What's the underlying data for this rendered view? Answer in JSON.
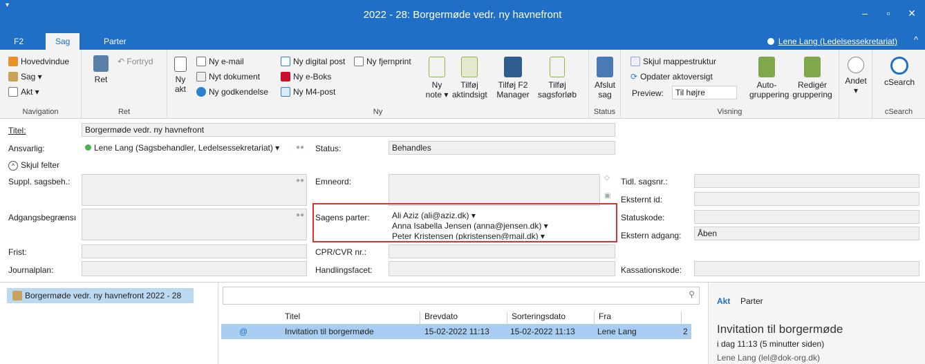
{
  "window": {
    "title": "2022 - 28: Borgermøde vedr. ny havnefront",
    "qa": "▾",
    "min": "‒",
    "max": "▫",
    "close": "✕"
  },
  "menu": {
    "tabs": [
      "F2",
      "Sag",
      "Parter"
    ],
    "user": "Lene Lang (Ledelsessekretariat)",
    "collapse": "^"
  },
  "ribbon": {
    "navigation": {
      "items": [
        "Hovedvindue",
        "Sag ▾",
        "Akt ▾"
      ],
      "label": "Navigation"
    },
    "ret": {
      "ret": "Ret",
      "fortryd": "Fortryd",
      "label": "Ret"
    },
    "ny": {
      "label": "Ny",
      "ny_akt": "Ny akt",
      "ny_email": "Ny e-mail",
      "nyt_dokument": "Nyt dokument",
      "ny_godkendelse": "Ny godkendelse",
      "ny_digital_post": "Ny digital post",
      "ny_eboks": "Ny e-Boks",
      "ny_m4": "Ny M4-post",
      "ny_fjernprint": "Ny fjernprint",
      "ny_note": "Ny note ▾",
      "tilfoj_aktindsigt": "Tilføj aktindsigt",
      "tilfoj_f2": "Tilføj F2 Manager",
      "tilfoj_sagsforlob": "Tilføj sagsforløb"
    },
    "status": {
      "label": "Status",
      "afslut": "Afslut sag"
    },
    "visning": {
      "label": "Visning",
      "skjul": "Skjul mappestruktur",
      "opdater": "Opdater aktoversigt",
      "preview_label": "Preview:",
      "preview_value": "Til højre",
      "auto": "Auto-gruppering",
      "rediger": "Redigér gruppering",
      "andet": "Andet ▾"
    },
    "csearch": {
      "label": "cSearch",
      "btn": "cSearch"
    }
  },
  "form": {
    "titel_label": "Titel:",
    "titel": "Borgermøde vedr. ny havnefront",
    "ansvarlig_label": "Ansvarlig:",
    "ansvarlig": "Lene Lang (Sagsbehandler, Ledelsessekretariat) ▾",
    "status_label": "Status:",
    "status": "Behandles",
    "skjul": "Skjul felter",
    "suppl_label": "Suppl. sagsbeh.:",
    "emneord_label": "Emneord:",
    "tidl_label": "Tidl. sagsnr.:",
    "ekstern_id_label": "Eksternt id:",
    "adgang_label": "Adgangsbegrænsı",
    "parter_label": "Sagens parter:",
    "parter": [
      "Ali Aziz (ali@aziz.dk) ▾",
      "Anna Isabella Jensen (anna@jensen.dk) ▾",
      "Peter Kristensen (pkristensen@mail.dk) ▾"
    ],
    "statuskode_label": "Statuskode:",
    "ekstern_adgang_label": "Ekstern adgang:",
    "ekstern_adgang": "Åben",
    "frist_label": "Frist:",
    "cpr_label": "CPR/CVR nr.:",
    "journalplan_label": "Journalplan:",
    "handlingsfacet_label": "Handlingsfacet:",
    "kassation_label": "Kassationskode:"
  },
  "tree": {
    "item": "Borgermøde vedr. ny havnefront 2022 - 28"
  },
  "list": {
    "headers": [
      "Titel",
      "Brevdato",
      "Sorteringsdato",
      "Fra"
    ],
    "row": {
      "titel": "Invitation til borgermøde",
      "brevdato": "15-02-2022 11:13",
      "sortering": "15-02-2022 11:13",
      "fra": "Lene Lang",
      "extra": "2"
    }
  },
  "preview": {
    "tab_akt": "Akt",
    "tab_parter": "Parter",
    "title": "Invitation til borgermøde",
    "time": "i dag 11:13 (5 minutter siden)",
    "from": "Lene Lang (lel@dok-org.dk)"
  },
  "colors": {
    "accent": "#1e6fc5",
    "selection": "#a9cdf0",
    "highlight": "#e03030"
  }
}
